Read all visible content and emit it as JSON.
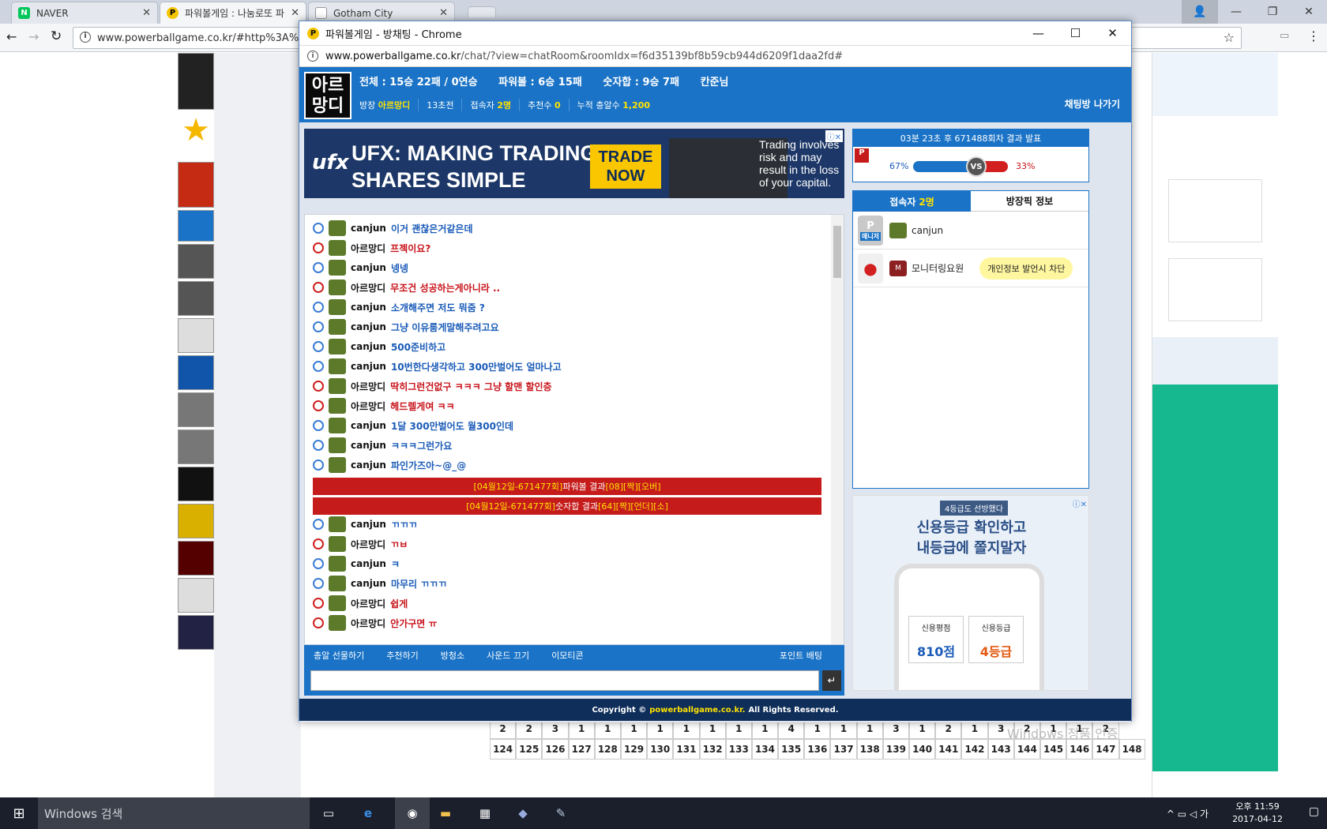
{
  "browser": {
    "tabs": [
      {
        "title": "NAVER",
        "favicon": "N"
      },
      {
        "title": "파워볼게임 : 나눔로또 파",
        "favicon": "P"
      },
      {
        "title": "Gotham City",
        "favicon": ""
      }
    ],
    "url": "www.powerballgame.co.kr/#http%3A%2F"
  },
  "popup": {
    "title": "파워볼게임 - 방채팅 - Chrome",
    "url_host": "www.powerballgame.co.kr",
    "url_path": "/chat/?view=chatRoom&roomIdx=f6d35139bf8b59cb944d6209f1daa2fd#",
    "avatar_text": "아르망디",
    "stats": {
      "total": "전체 : 15승 22패 / 0연승",
      "powerball": "파워볼 : 6승 15패",
      "numsum": "숫자합 : 9승 7패",
      "extra": "칸준님"
    },
    "room": {
      "host_label": "방장",
      "host": "아르망디",
      "time": "13초전",
      "users_label": "접속자",
      "users": "2명",
      "recommend_label": "추천수",
      "recommend": "0",
      "gift_label": "누적 충알수",
      "gift": "1,200",
      "exit": "채팅방 나가기"
    },
    "ad": {
      "logo": "ufx",
      "headline1": "UFX: MAKING TRADING",
      "headline2": "SHARES SIMPLE",
      "cta1": "TRADE",
      "cta2": "NOW",
      "risk": "Trading involves risk and may result in the loss of your capital."
    },
    "messages": [
      {
        "nick": "canjun",
        "text": "이거 괜찮은거같은데",
        "side": "b"
      },
      {
        "nick": "아르망디",
        "text": "프젝이요?",
        "side": "r"
      },
      {
        "nick": "canjun",
        "text": "넹넹",
        "side": "b"
      },
      {
        "nick": "아르망디",
        "text": "무조건 성공하는게아니라 ..",
        "side": "r"
      },
      {
        "nick": "canjun",
        "text": "소개해주면 저도 뭐줌 ?",
        "side": "b"
      },
      {
        "nick": "canjun",
        "text": "그냥 이유룸게말해주려고요",
        "side": "b"
      },
      {
        "nick": "canjun",
        "text": "500준비하고",
        "side": "b"
      },
      {
        "nick": "canjun",
        "text": "10번한다생각하고 300만벌어도 얼마나고",
        "side": "b"
      },
      {
        "nick": "아르망디",
        "text": "딱히그런건없구 ㅋㅋㅋ 그냥 할맨 할인층",
        "side": "r"
      },
      {
        "nick": "아르망디",
        "text": "헤드렐게여 ㅋㅋ",
        "side": "r"
      },
      {
        "nick": "canjun",
        "text": "1달 300만벌어도 월300인데",
        "side": "b"
      },
      {
        "nick": "canjun",
        "text": "ㅋㅋㅋ그런가요",
        "side": "b"
      },
      {
        "nick": "canjun",
        "text": "파인가즈아~@_@",
        "side": "b"
      }
    ],
    "results": [
      {
        "pre": "[04월12일-671477회]",
        "mid": " 파워볼 결과 ",
        "res": "[08][짝][오버]"
      },
      {
        "pre": "[04월12일-671477회]",
        "mid": " 숫자합 결과 ",
        "res": "[64][짝][언더][소]"
      }
    ],
    "messages2": [
      {
        "nick": "canjun",
        "text": "ㄲㄲㄲ",
        "side": "b"
      },
      {
        "nick": "아르망디",
        "text": "ㄲㅂ",
        "side": "r"
      },
      {
        "nick": "canjun",
        "text": "ㅋ",
        "side": "b"
      },
      {
        "nick": "canjun",
        "text": "마무리 ㄲㄲㄲ",
        "side": "b"
      },
      {
        "nick": "아르망디",
        "text": "쉽게",
        "side": "r"
      },
      {
        "nick": "아르망디",
        "text": "안가구면 ㅠ",
        "side": "r"
      }
    ],
    "bottom_bar": [
      "총알 선물하기",
      "추천하기",
      "방청소",
      "사운드 끄기",
      "이모티콘"
    ],
    "point_bet": "포인트 배팅",
    "send_icon": "↵",
    "copyright_pre": "Copyright ©",
    "copyright_site": "powerballgame.co.kr.",
    "copyright_post": "All Rights Reserved.",
    "vs": {
      "header": "03분 23초 후 671488회차 결과 발표",
      "left_pct": "67%",
      "right_pct": "33%",
      "vs": "VS",
      "left_value": 67,
      "right_value": 33
    },
    "users_tab": {
      "label": "접속자",
      "count": "2명",
      "info": "방장픽 정보"
    },
    "users": [
      {
        "name": "canjun",
        "tag": "매니저"
      },
      {
        "name": "모니터링요원",
        "tip": "개인정보 발언시 차단"
      }
    ],
    "ad2": {
      "tag": "4등급도 선방했다",
      "line1": "신용등급 확인하고",
      "line2": "내등급에 쫄지말자",
      "card1_label": "신용평점",
      "card1_value": "810점",
      "card2_label": "신용등급",
      "card2_value": "4등급"
    }
  },
  "background": {
    "bottom_numbers_top": [
      "2",
      "2",
      "3",
      "1",
      "1",
      "1",
      "1",
      "1",
      "1",
      "1",
      "1",
      "4",
      "1",
      "1",
      "1",
      "3",
      "1",
      "2",
      "1",
      "3",
      "2",
      "1",
      "1",
      "2"
    ],
    "bottom_numbers": [
      "124",
      "125",
      "126",
      "127",
      "128",
      "129",
      "130",
      "131",
      "132",
      "133",
      "134",
      "135",
      "136",
      "137",
      "138",
      "139",
      "140",
      "141",
      "142",
      "143",
      "144",
      "145",
      "146",
      "147",
      "148"
    ],
    "watermark": "Windows 정품 인증"
  },
  "taskbar": {
    "search": "Windows 검색",
    "time": "오후 11:59",
    "date": "2017-04-12"
  }
}
